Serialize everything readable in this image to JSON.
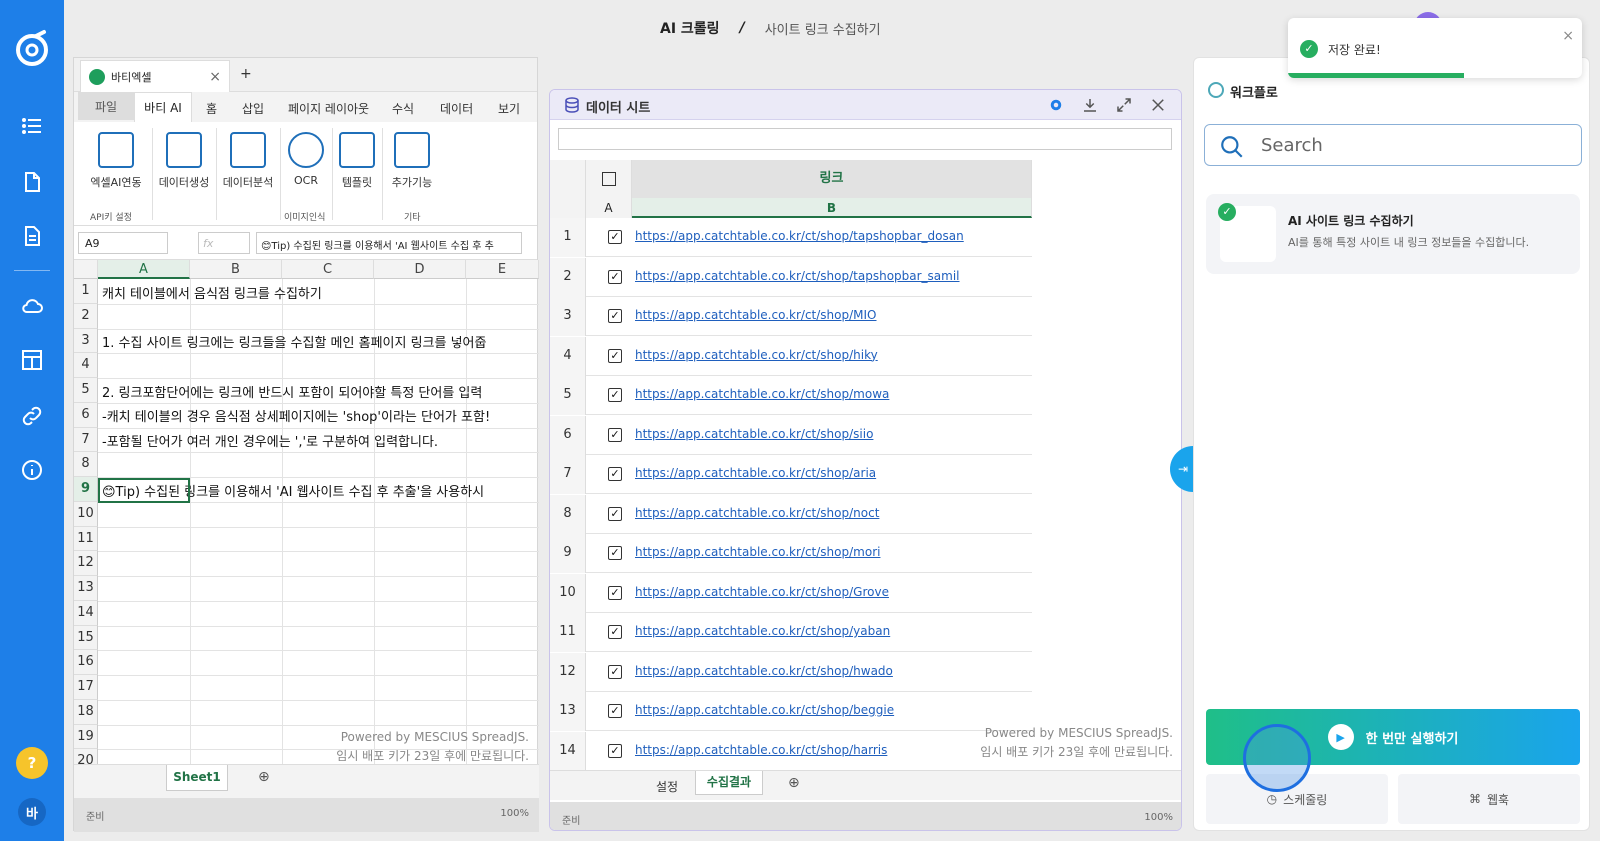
{
  "topbar": {
    "breadcrumb_root": "AI 크롤링",
    "breadcrumb_sep": "/",
    "breadcrumb_page": "사이트 링크 수집하기"
  },
  "sidebar": {
    "help_label": "?",
    "user_initial": "바",
    "items": [
      "list-icon",
      "file-icon",
      "document-icon",
      "cloud-icon",
      "layout-icon",
      "link-icon",
      "info-icon"
    ]
  },
  "excel": {
    "tab_title": "바티엑셀",
    "close": "×",
    "add_tab": "+",
    "ribbon_tabs": {
      "file": "파일",
      "bati_ai": "바티 AI",
      "home": "홈",
      "insert": "삽입",
      "page_layout": "페이지 레이아웃",
      "formula": "수식",
      "data": "데이터",
      "view": "보기"
    },
    "ribbon": {
      "excel_ai": "엑셀AI연동",
      "data_gen": "데이터생성",
      "data_analysis": "데이터분석",
      "ocr": "OCR",
      "template": "템플릿",
      "extra": "추가기능",
      "group_api": "API키 설정",
      "group_image": "이미지인식",
      "group_etc": "기타"
    },
    "namebox": "A9",
    "fx": "fx",
    "formula": "😊Tip) 수집된 링크를 이용해서 'AI 웹사이트 수집 후 추",
    "columns": [
      "A",
      "B",
      "C",
      "D",
      "E"
    ],
    "rows": [
      "1",
      "2",
      "3",
      "4",
      "5",
      "6",
      "7",
      "8",
      "9",
      "10",
      "11",
      "12",
      "13",
      "14",
      "15",
      "16",
      "17",
      "18",
      "19",
      "20"
    ],
    "cells": {
      "r1": "캐치 테이블에서 음식점 링크를 수집하기",
      "r3": "1. 수집 사이트 링크에는 링크들을 수집할 메인 홈페이지 링크를 넣어줍",
      "r5": "2. 링크포함단어에는 링크에 반드시 포함이 되어야할 특정 단어를 입력",
      "r6": "-캐치 테이블의 경우 음식점 상세페이지에는 'shop'이라는 단어가 포함!",
      "r7": "-포함될 단어가 여러 개인 경우에는 ','로 구분하여 입력합니다.",
      "r9": "😊Tip) 수집된 링크를 이용해서 'AI 웹사이트 수집 후 추출'을 사용하시"
    },
    "watermark1": "Powered by MESCIUS SpreadJS.",
    "watermark2": "임시 배포 키가 23일 후에 만료됩니다.",
    "sheet_tab": "Sheet1",
    "status": "준비",
    "zoom": "100%"
  },
  "datasheet": {
    "title": "데이터 시트",
    "header_label": "링크",
    "col_a": "A",
    "col_b": "B",
    "rows": [
      {
        "n": "1",
        "url": "https://app.catchtable.co.kr/ct/shop/tapshopbar_dosan"
      },
      {
        "n": "2",
        "url": "https://app.catchtable.co.kr/ct/shop/tapshopbar_samil"
      },
      {
        "n": "3",
        "url": "https://app.catchtable.co.kr/ct/shop/MIO"
      },
      {
        "n": "4",
        "url": "https://app.catchtable.co.kr/ct/shop/hiky"
      },
      {
        "n": "5",
        "url": "https://app.catchtable.co.kr/ct/shop/mowa"
      },
      {
        "n": "6",
        "url": "https://app.catchtable.co.kr/ct/shop/siio"
      },
      {
        "n": "7",
        "url": "https://app.catchtable.co.kr/ct/shop/aria"
      },
      {
        "n": "8",
        "url": "https://app.catchtable.co.kr/ct/shop/noct"
      },
      {
        "n": "9",
        "url": "https://app.catchtable.co.kr/ct/shop/mori"
      },
      {
        "n": "10",
        "url": "https://app.catchtable.co.kr/ct/shop/Grove"
      },
      {
        "n": "11",
        "url": "https://app.catchtable.co.kr/ct/shop/yaban"
      },
      {
        "n": "12",
        "url": "https://app.catchtable.co.kr/ct/shop/hwado"
      },
      {
        "n": "13",
        "url": "https://app.catchtable.co.kr/ct/shop/beggie"
      },
      {
        "n": "14",
        "url": "https://app.catchtable.co.kr/ct/shop/harris"
      }
    ],
    "watermark1": "Powered by MESCIUS SpreadJS.",
    "watermark2": "임시 배포 키가 23일 후에 만료됩니다.",
    "tab_settings": "설정",
    "tab_results": "수집결과",
    "status": "준비",
    "zoom": "100%"
  },
  "workflow": {
    "title": "워크플로",
    "search_placeholder": "Search",
    "card_title": "AI 사이트 링크 수집하기",
    "card_desc": "AI를 통해 특정 사이트 내 링크 정보들을 수집합니다.",
    "run_once": "한 번만 실행하기",
    "schedule": "스케줄링",
    "webhook": "웹훅"
  },
  "toast": {
    "message": "저장 완료!",
    "close": "×",
    "progress": 0.6
  }
}
